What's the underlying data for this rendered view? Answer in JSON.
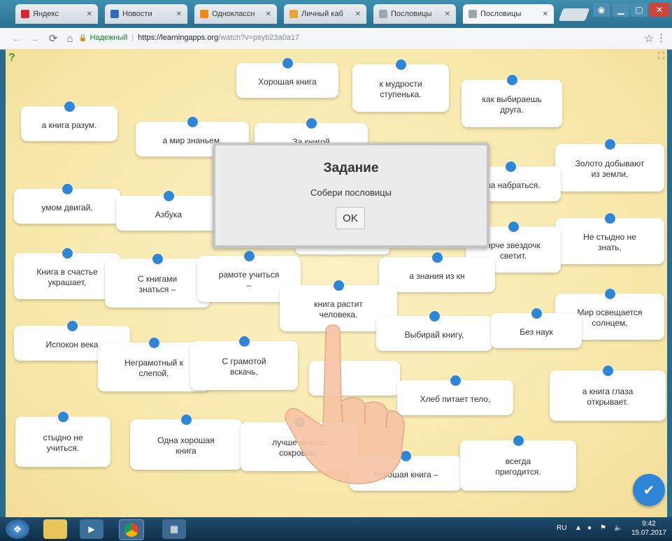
{
  "browser": {
    "tabs": [
      {
        "label": "Яндекс",
        "color": "#d8262c"
      },
      {
        "label": "Новости",
        "color": "#2f6cb5"
      },
      {
        "label": "Одноклассн",
        "color": "#f08a18"
      },
      {
        "label": "Личный каб",
        "color": "#e8a43a"
      },
      {
        "label": "Пословицы",
        "color": "#9aa7b0"
      },
      {
        "label": "Пословицы",
        "color": "#9aa7b0"
      }
    ],
    "secure_label": "Надежный",
    "url_host": "https://learningapps.org",
    "url_path": "/watch?v=psyb23a0a17"
  },
  "dialog": {
    "title": "Задание",
    "text": "Собери пословицы",
    "ok_label": "OK"
  },
  "cards": [
    "Хорошая книга",
    "к мудрости\nступенька.",
    "как выбираешь\nдруга.",
    "а книга разум.",
    "а мир знаньем.",
    "За книгой",
    "Золото добывают\nиз земли,",
    "ума набраться.",
    "умом двигай.",
    "Азбука",
    "Не стыдно не\nзнать,",
    "ярче звездочк\nсветит.",
    "Книга в счастье\nукрашает,",
    "С книгами\nзнаться –",
    "рамоте учиться\n–",
    "а знания из кн",
    "книга растит\nчеловека.",
    "Мир освещается\nсолнцем,",
    "Выбирай книгу,",
    "Без наук",
    "Испокон века",
    "Неграмотный к\nслепой,",
    "С грамотой\nвскачь,",
    "",
    "Хлеб питает тело,",
    "а книга глаза\nоткрывает.",
    "стыдно не\nучиться.",
    "Одна хорошая\nкнига",
    "лучше многих\nсокровищ.",
    "Хорошая книга –",
    "всегда\nпригодится.",
    ""
  ],
  "taskbar": {
    "lang": "RU",
    "time": "9:42",
    "date": "15.07.2017"
  }
}
